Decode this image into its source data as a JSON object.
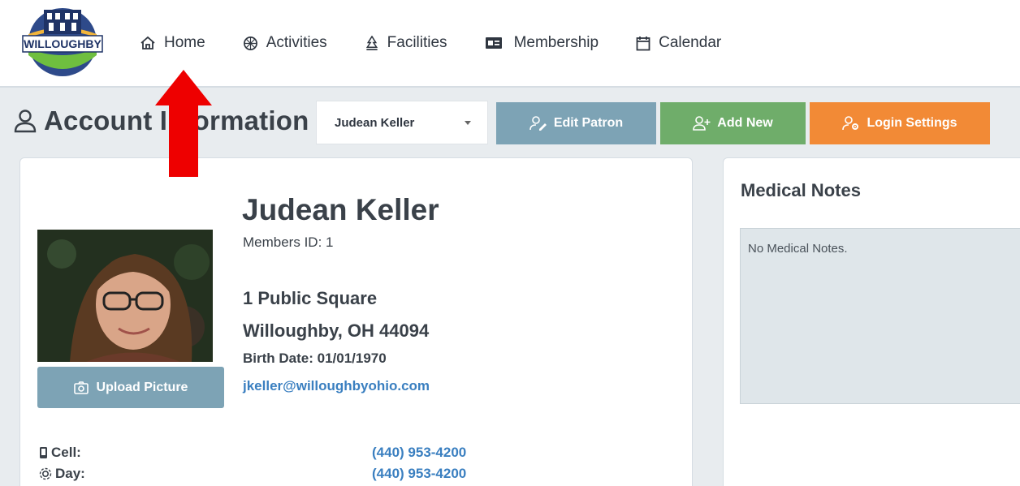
{
  "nav": {
    "logo_text": "WILLOUGHBY",
    "items": [
      {
        "label": "Home",
        "icon": "home-icon"
      },
      {
        "label": "Activities",
        "icon": "activities-icon"
      },
      {
        "label": "Facilities",
        "icon": "facilities-icon"
      },
      {
        "label": "Membership",
        "icon": "membership-card-icon"
      },
      {
        "label": "Calendar",
        "icon": "calendar-icon"
      }
    ]
  },
  "header": {
    "title": "Account Information",
    "selected_patron": "Judean Keller",
    "buttons": {
      "edit_patron": "Edit Patron",
      "add_new": "Add New",
      "login_settings": "Login Settings"
    }
  },
  "patron": {
    "name": "Judean Keller",
    "member_id": "Members ID: 1",
    "address_line1": "1 Public Square",
    "address_line2": "Willoughby, OH 44094",
    "birth_date": "Birth Date: 01/01/1970",
    "email": "jkeller@willoughbyohio.com",
    "upload_label": "Upload Picture",
    "phones": [
      {
        "label": "Cell:",
        "value": "(440) 953-4200"
      },
      {
        "label": "Day:",
        "value": "(440) 953-4200"
      }
    ]
  },
  "medical": {
    "title": "Medical Notes",
    "text": "No Medical Notes."
  },
  "colors": {
    "edit_button": "#7da3b5",
    "add_button": "#6fad6a",
    "login_button": "#f28a36",
    "link": "#3a7fc0",
    "annotation_arrow": "#ee0000"
  }
}
